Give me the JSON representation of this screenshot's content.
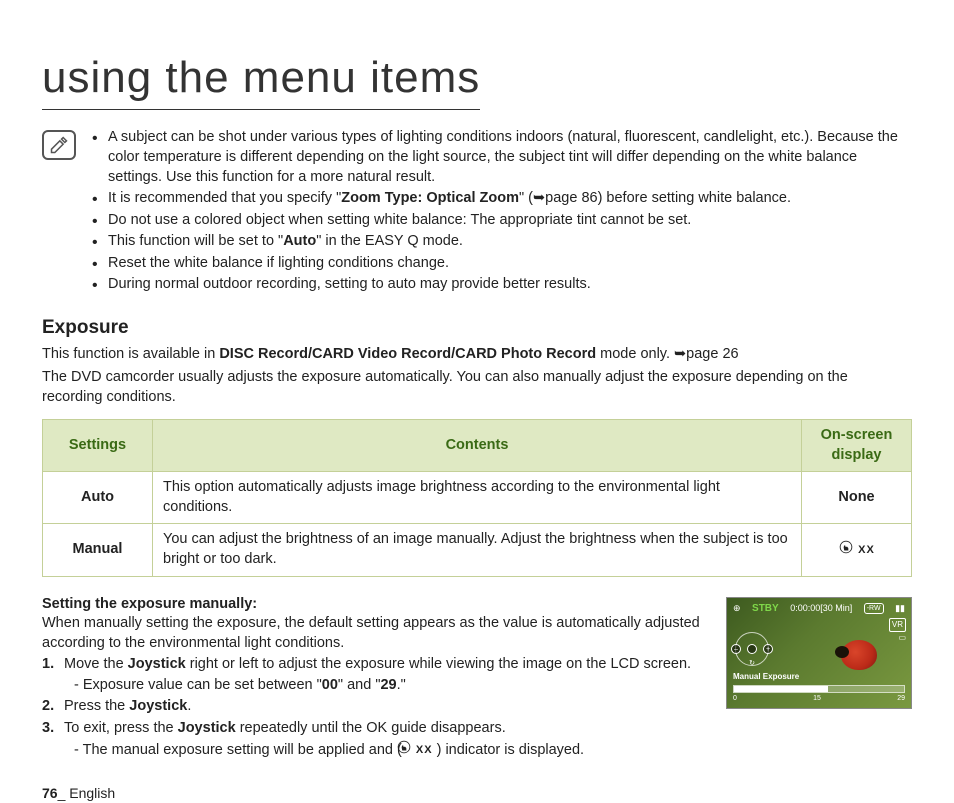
{
  "title": "using the menu items",
  "note_bullets": [
    {
      "pre": "A subject can be shot under various types of lighting conditions indoors (natural, fluorescent, candlelight, etc.). Because the color temperature is different depending on the light source, the subject tint will differ depending on the white balance settings. Use this function for a more natural result."
    },
    {
      "pre": "It is recommended that you specify \"",
      "b": "Zoom Type: Optical Zoom",
      "post": "\" (➥page 86) before setting white balance."
    },
    {
      "pre": "Do not use a colored object when setting white balance: The appropriate tint cannot be set."
    },
    {
      "pre": "This function will be set to \"",
      "b": "Auto",
      "post": "\" in the EASY Q mode."
    },
    {
      "pre": "Reset the white balance if lighting conditions change."
    },
    {
      "pre": "During normal outdoor recording, setting to auto may provide better results."
    }
  ],
  "exposure": {
    "heading": "Exposure",
    "intro_pre": "This function is available in ",
    "intro_bold": "DISC Record/CARD Video Record/CARD Photo Record",
    "intro_post": " mode only. ➥page 26",
    "intro2": "The DVD camcorder usually adjusts the exposure automatically. You can also manually adjust the exposure depending on the recording conditions."
  },
  "table": {
    "h1": "Settings",
    "h2": "Contents",
    "h3": "On-screen display",
    "rows": [
      {
        "s": "Auto",
        "c": "This option automatically adjusts image brightness according to the environmental light conditions.",
        "d": "None"
      },
      {
        "s": "Manual",
        "c": "You can adjust the brightness of an image manually. Adjust the brightness when the subject is too bright or too dark.",
        "d": "icon"
      }
    ]
  },
  "manual": {
    "heading": "Setting the exposure manually:",
    "intro": "When manually setting the exposure, the default setting appears as the value is automatically adjusted according to the environmental light conditions.",
    "steps": [
      {
        "pre": "Move the ",
        "b": "Joystick",
        "post": " right or left to adjust the exposure while viewing the image on the LCD screen.",
        "sub_pre": "Exposure value can be set between \"",
        "sub_b1": "00",
        "sub_mid": "\" and \"",
        "sub_b2": "29",
        "sub_post": ".\""
      },
      {
        "pre": "Press the ",
        "b": "Joystick",
        "post": "."
      },
      {
        "pre": "To exit, press the ",
        "b": "Joystick",
        "post": " repeatedly until the OK guide disappears.",
        "sub": "The manual exposure setting will be applied and (     ) indicator is displayed.",
        "has_icon": true
      }
    ]
  },
  "lcd": {
    "stby": "STBY",
    "time": "0:00:00[30 Min]",
    "label": "Manual Exposure",
    "bar_min": "0",
    "bar_max": "29",
    "cur": "15",
    "vr": "VR",
    "rw": "-RW"
  },
  "footer": {
    "page": "76",
    "sep": "_ ",
    "lang": "English"
  },
  "xx": "XX"
}
